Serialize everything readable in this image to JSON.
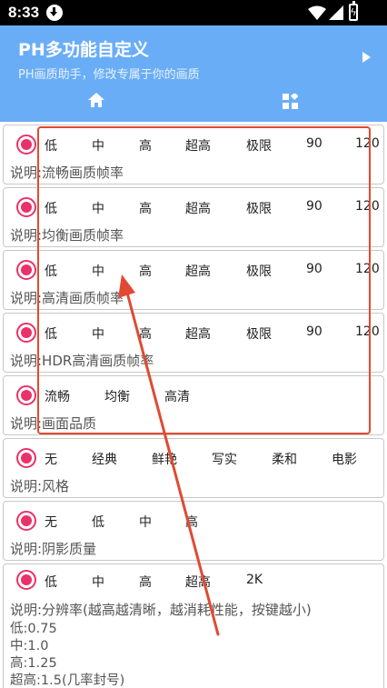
{
  "status_bar": {
    "time": "8:33"
  },
  "app_bar": {
    "title": "PH多功能自定义",
    "subtitle": "PH画质助手，修改专属于你的画质"
  },
  "cards": [
    {
      "options": [
        "低",
        "中",
        "高",
        "超高",
        "极限",
        "90",
        "120"
      ],
      "description": "说明:流畅画质帧率"
    },
    {
      "options": [
        "低",
        "中",
        "高",
        "超高",
        "极限",
        "90",
        "120"
      ],
      "description": "说明:均衡画质帧率"
    },
    {
      "options": [
        "低",
        "中",
        "高",
        "超高",
        "极限",
        "90",
        "120"
      ],
      "description": "说明:高清画质帧率"
    },
    {
      "options": [
        "低",
        "中",
        "高",
        "超高",
        "极限",
        "90",
        "120"
      ],
      "description": "说明:HDR高清画质帧率"
    },
    {
      "options": [
        "流畅",
        "均衡",
        "高清"
      ],
      "description": "说明:画面品质"
    },
    {
      "options": [
        "无",
        "经典",
        "鲜艳",
        "写实",
        "柔和",
        "电影"
      ],
      "description": "说明:风格"
    },
    {
      "options": [
        "无",
        "低",
        "中",
        "高"
      ],
      "description": "说明:阴影质量"
    },
    {
      "options": [
        "低",
        "中",
        "高",
        "超高",
        "2K"
      ],
      "description": "说明:分辨率(越高越清晰，越消耗性能，按键越小)",
      "extra_lines": [
        "低:0.75",
        "中:1.0",
        "高:1.25",
        "超高:1.5(几率封号)"
      ]
    }
  ],
  "colors": {
    "accent": "#6aadf7",
    "radio": "#e8336a",
    "annotation": "#e04a33"
  }
}
